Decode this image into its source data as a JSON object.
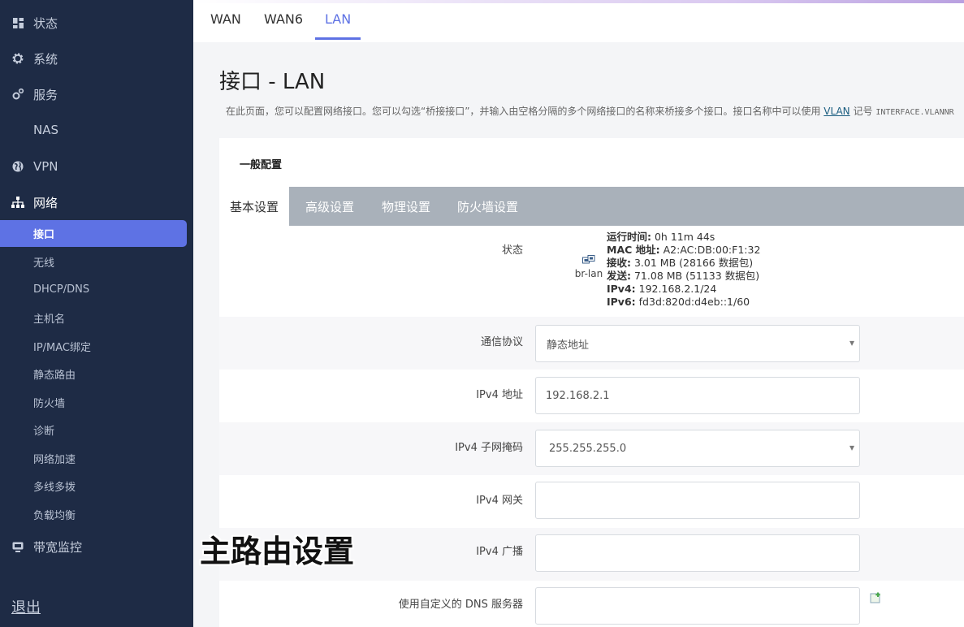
{
  "sidebar": {
    "items": [
      {
        "label": "状态",
        "icon": "dashboard-icon"
      },
      {
        "label": "系统",
        "icon": "gear-icon"
      },
      {
        "label": "服务",
        "icon": "cogs-icon"
      },
      {
        "label": "NAS",
        "icon": ""
      },
      {
        "label": "VPN",
        "icon": "globe-icon"
      },
      {
        "label": "网络",
        "icon": "sitemap-icon"
      }
    ],
    "sub_items": [
      "接口",
      "无线",
      "DHCP/DNS",
      "主机名",
      "IP/MAC绑定",
      "静态路由",
      "防火墙",
      "诊断",
      "网络加速",
      "多线多拨",
      "负载均衡"
    ],
    "bandwidth": {
      "label": "带宽监控",
      "icon": "monitor-icon"
    },
    "logout": "退出"
  },
  "top_tabs": [
    "WAN",
    "WAN6",
    "LAN"
  ],
  "page": {
    "title": "接口 - LAN",
    "desc_before": "在此页面，您可以配置网络接口。您可以勾选“桥接接口”，并输入由空格分隔的多个网络接口的名称来桥接多个接口。接口名称中可以使用",
    "desc_link": "VLAN",
    "desc_after": "记号",
    "desc_mono": "INTERFACE.VLANNR"
  },
  "panel": {
    "section_title": "一般配置",
    "tabs": [
      "基本设置",
      "高级设置",
      "物理设置",
      "防火墙设置"
    ]
  },
  "status": {
    "label": "状态",
    "device": "br-lan",
    "uptime_key": "运行时间:",
    "uptime": "0h 11m 44s",
    "mac_key": "MAC 地址:",
    "mac": "A2:AC:DB:00:F1:32",
    "rx_key": "接收:",
    "rx": "3.01 MB (28166 数据包)",
    "tx_key": "发送:",
    "tx": "71.08 MB (51133 数据包)",
    "ipv4_key": "IPv4:",
    "ipv4": "192.168.2.1/24",
    "ipv6_key": "IPv6:",
    "ipv6": "fd3d:820d:d4eb::1/60"
  },
  "form": {
    "protocol": {
      "label": "通信协议",
      "value": "静态地址"
    },
    "ipv4_addr": {
      "label": "IPv4 地址",
      "value": "192.168.2.1"
    },
    "netmask": {
      "label": "IPv4 子网掩码",
      "value": "255.255.255.0"
    },
    "gateway": {
      "label": "IPv4 网关",
      "value": ""
    },
    "broadcast": {
      "label": "IPv4 广播",
      "value": ""
    },
    "dns": {
      "label": "使用自定义的 DNS 服务器",
      "value": ""
    }
  },
  "overlay_caption": "主路由设置"
}
